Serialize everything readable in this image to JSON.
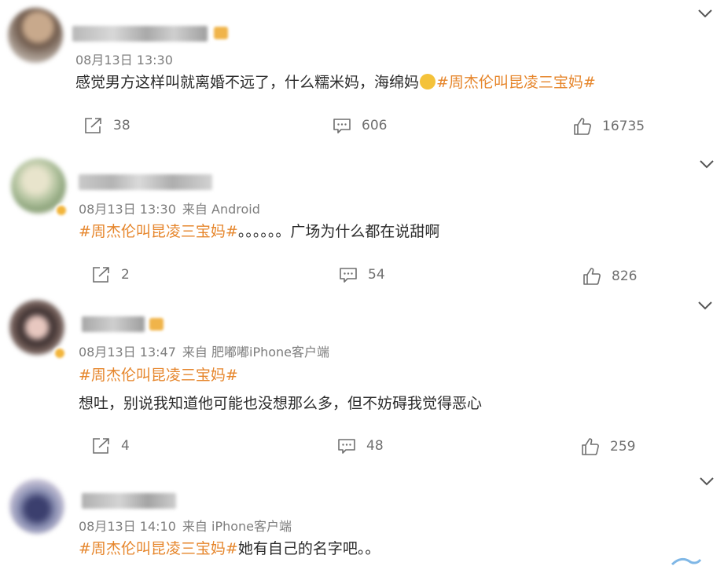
{
  "comments": [
    {
      "time": "08月13日 13:30",
      "source": "",
      "hashtag": "#周杰伦叫昆凌三宝妈#",
      "lines": [
        "感觉男方这样叫就离婚不远了，什么糯米妈，海绵妈"
      ],
      "repost_count": "38",
      "comment_count": "606",
      "like_count": "16735",
      "has_emoji": true
    },
    {
      "time": "08月13日 13:30",
      "source": "来自 Android",
      "hashtag": "#周杰伦叫昆凌三宝妈#",
      "lines": [
        "。。。。。。广场为什么都在说甜啊"
      ],
      "repost_count": "2",
      "comment_count": "54",
      "like_count": "826"
    },
    {
      "time": "08月13日 13:47",
      "source": "来自 肥嘟嘟iPhone客户端",
      "hashtag": "#周杰伦叫昆凌三宝妈#",
      "lines": [
        "想吐，别说我知道他可能也没想那么多，但不妨碍我觉得恶心"
      ],
      "repost_count": "4",
      "comment_count": "48",
      "like_count": "259"
    },
    {
      "time": "08月13日 14:10",
      "source": "来自 iPhone客户端",
      "hashtag": "#周杰伦叫昆凌三宝妈#",
      "lines": [
        "她有自己的名字吧。。"
      ]
    }
  ],
  "icons": {
    "repost": "repost-icon",
    "comment": "comment-icon",
    "like": "thumbs-up-icon",
    "more": "chevron-down-icon"
  },
  "colors": {
    "hashtag": "#e6862c",
    "meta": "#7d7d7d",
    "text": "#2b2b2b",
    "icon": "#6f6f6f"
  }
}
